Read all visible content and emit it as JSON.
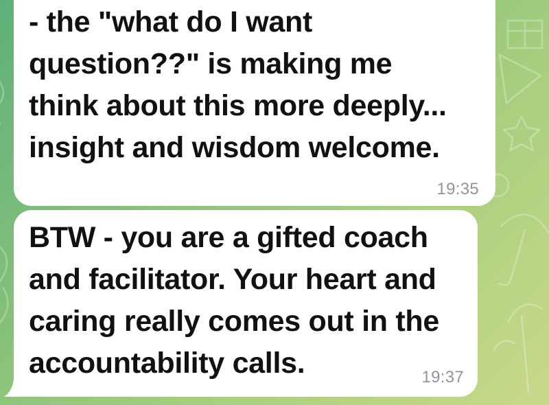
{
  "chat": {
    "background_color": "#86c17a",
    "bubble_color": "#ffffff",
    "messages": [
      {
        "text": "- the \"what do I want\nquestion??\" is making me\nthink about this more deeply...\ninsight and wisdom welcome.",
        "time": "19:35"
      },
      {
        "text": "BTW - you are a gifted coach\nand facilitator. Your heart and\ncaring really comes out in the\naccountability calls.",
        "time": "19:37"
      }
    ]
  }
}
